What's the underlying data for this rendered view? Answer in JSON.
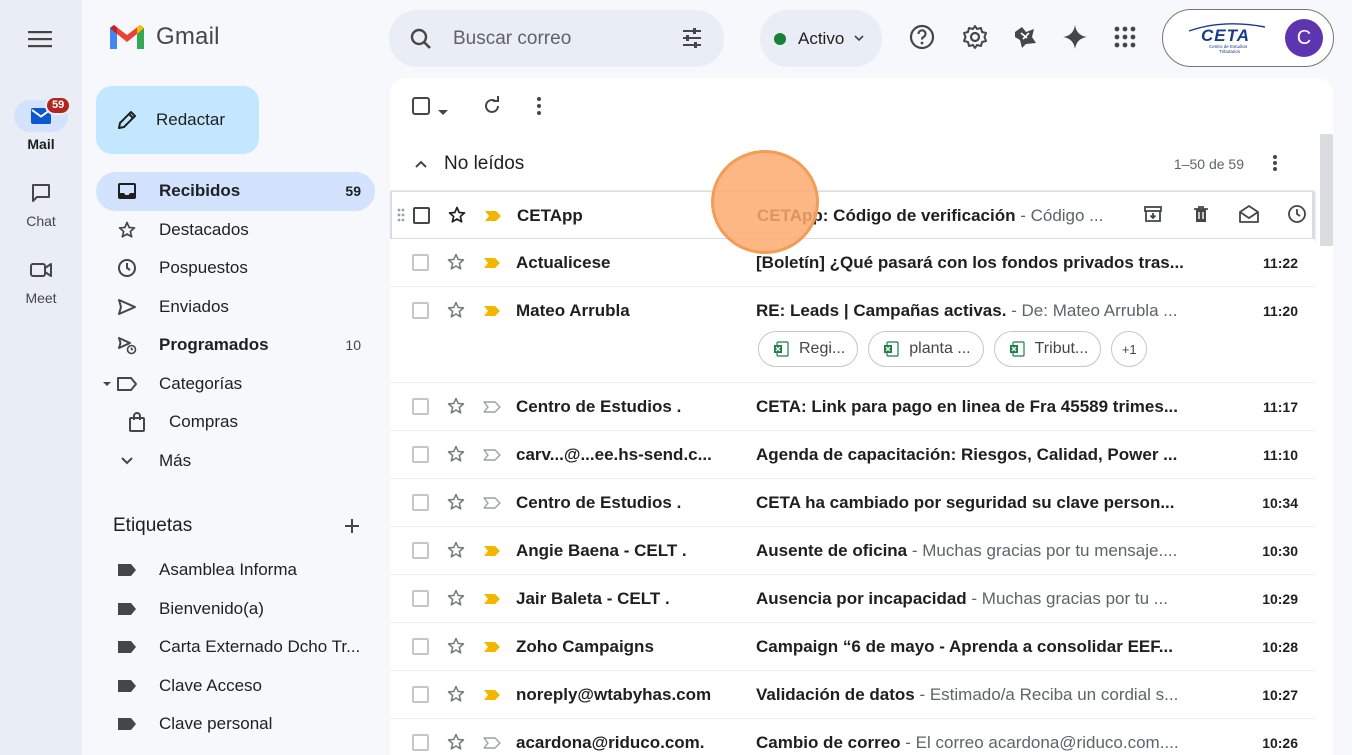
{
  "rail": {
    "items": [
      {
        "label": "Mail",
        "badge": "59",
        "icon": "mail-icon"
      },
      {
        "label": "Chat",
        "icon": "chat-icon"
      },
      {
        "label": "Meet",
        "icon": "video-icon"
      }
    ]
  },
  "app": {
    "name": "Gmail"
  },
  "compose": {
    "label": "Redactar"
  },
  "nav": [
    {
      "label": "Recibidos",
      "count": "59",
      "icon": "inbox-icon"
    },
    {
      "label": "Destacados",
      "icon": "star-icon"
    },
    {
      "label": "Pospuestos",
      "icon": "clock-icon"
    },
    {
      "label": "Enviados",
      "icon": "send-icon"
    },
    {
      "label": "Programados",
      "count": "10",
      "icon": "scheduled-send-icon"
    },
    {
      "label": "Categorías",
      "icon": "label-icon"
    },
    {
      "label": "Compras",
      "icon": "shopping-bag-icon"
    },
    {
      "label": "Más",
      "icon": "chevron-down-icon"
    }
  ],
  "labels": {
    "title": "Etiquetas",
    "items": [
      "Asamblea Informa",
      "Bienvenido(a)",
      "Carta Externado Dcho Tr...",
      "Clave Acceso",
      "Clave personal"
    ]
  },
  "search": {
    "placeholder": "Buscar correo"
  },
  "status": {
    "label": "Activo",
    "color": "#188038"
  },
  "account": {
    "logo_text": "CETA",
    "logo_sub": "Centro de Estudios Tributarios",
    "avatar": "C",
    "avatar_color": "#5e35b1"
  },
  "section": {
    "title": "No leídos",
    "range": "1–50 de 59"
  },
  "emails": [
    {
      "sender": "CETApp",
      "subject": "CETApp: Código de verificación",
      "snippet": " - Código ...",
      "time": "",
      "important": true,
      "hover": true
    },
    {
      "sender": "Actualicese",
      "subject": "[Boletín] ¿Qué pasará con los fondos privados tras...",
      "snippet": "",
      "time": "11:22",
      "important": true
    },
    {
      "sender": "Mateo Arrubla",
      "subject": "RE: Leads | Campañas activas.",
      "snippet": " - De: Mateo Arrubla ...",
      "time": "11:20",
      "important": true,
      "attachments": [
        "Regi...",
        "planta ...",
        "Tribut...",
        "+1"
      ]
    },
    {
      "sender": "Centro de Estudios .",
      "subject": "CETA: Link para pago en linea de Fra 45589 trimes...",
      "snippet": "",
      "time": "11:17",
      "important": false
    },
    {
      "sender": "carv...@...ee.hs-send.c...",
      "subject": "Agenda de capacitación: Riesgos, Calidad, Power ...",
      "snippet": "",
      "time": "11:10",
      "important": false
    },
    {
      "sender": "Centro de Estudios .",
      "subject": "CETA ha cambiado por seguridad su clave person...",
      "snippet": "",
      "time": "10:34",
      "important": false
    },
    {
      "sender": "Angie Baena - CELT .",
      "subject": "Ausente de oficina",
      "snippet": " - Muchas gracias por tu mensaje....",
      "time": "10:30",
      "important": true
    },
    {
      "sender": "Jair Baleta - CELT .",
      "subject": "Ausencia por incapacidad",
      "snippet": " - Muchas gracias por tu ...",
      "time": "10:29",
      "important": true
    },
    {
      "sender": "Zoho Campaigns",
      "subject": "Campaign “6 de mayo - Aprenda a consolidar EEF...",
      "snippet": "",
      "time": "10:28",
      "important": true
    },
    {
      "sender": "noreply@wtabyhas.com",
      "subject": "Validación de datos",
      "snippet": " - Estimado/a Reciba un cordial s...",
      "time": "10:27",
      "important": true
    },
    {
      "sender": "acardona@riduco.com.",
      "subject": "Cambio de correo",
      "snippet": " - El correo acardona@riduco.com....",
      "time": "10:26",
      "important": false
    }
  ]
}
